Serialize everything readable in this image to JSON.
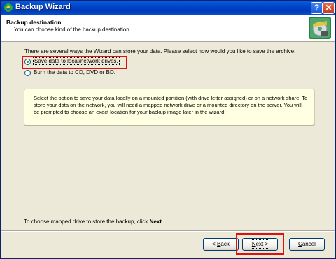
{
  "window": {
    "title": "Backup Wizard",
    "help_button": "?",
    "close_button": "✕"
  },
  "header": {
    "title": "Backup destination",
    "subtitle": "You can choose kind of the backup destination."
  },
  "content": {
    "intro": "There are several ways the Wizard can store your data. Please select how would you like to save the archive:",
    "options": [
      {
        "label_first": "S",
        "label_rest": "ave data to local/network drives.",
        "selected": true
      },
      {
        "label_first": "B",
        "label_rest": "urn the data to CD, DVD or BD.",
        "selected": false
      }
    ],
    "info_text": "Select the option to save your data locally on a mounted partition (with drive letter assigned) or on a network share. To store your data on the network, you will need a mapped network drive or a mounted directory on the server. You will be prompted to choose an exact location for your backup image later in the wizard.",
    "bottom_text": "To choose mapped drive to store the backup, click ",
    "bottom_bold": "Next"
  },
  "buttons": {
    "back_prefix": "< ",
    "back_u": "B",
    "back_rest": "ack",
    "next_u": "N",
    "next_rest": "ext >",
    "cancel_u": "C",
    "cancel_rest": "ancel"
  },
  "colors": {
    "highlight": "#e01010",
    "titlebar": "#0044c8",
    "dialog_bg": "#ece9d8",
    "info_bg": "#ffffe1"
  }
}
